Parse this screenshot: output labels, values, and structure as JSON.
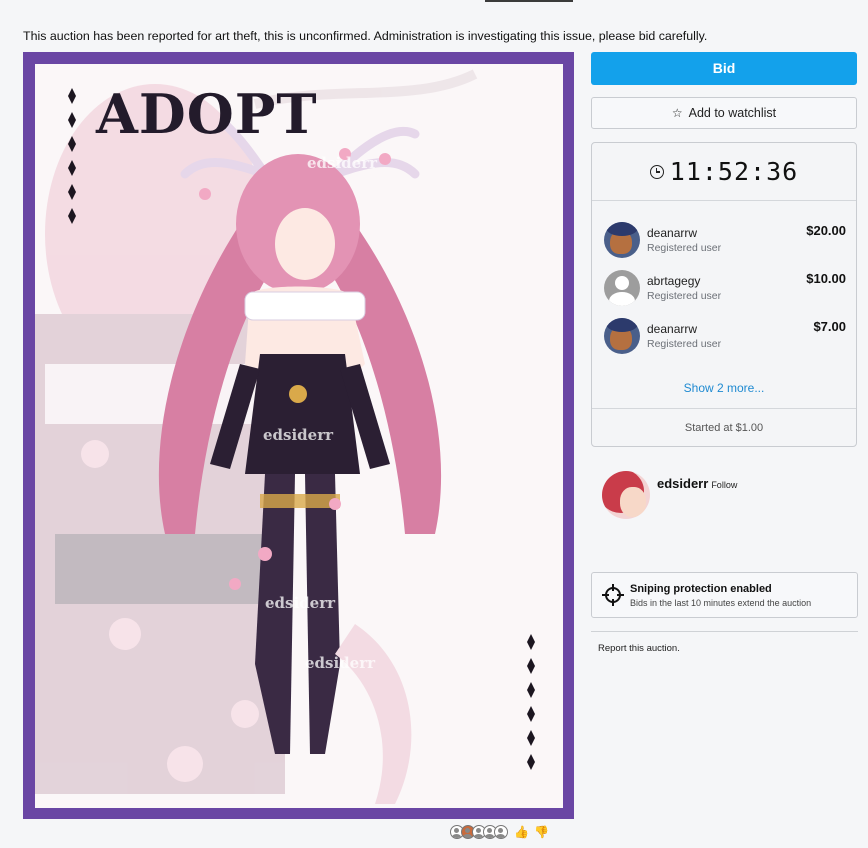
{
  "notice": "This auction has been reported for art theft, this is unconfirmed. Administration is investigating this issue, please bid carefully.",
  "artwork": {
    "title_text": "ADOPT",
    "watermark": "edsiderr",
    "frame_color": "#6a46a4"
  },
  "bid_button": "Bid",
  "watchlist": {
    "label": "Add to watchlist",
    "icon": "star-outline-icon"
  },
  "timer": {
    "icon": "clock-icon",
    "value": "11:52:36"
  },
  "bids": [
    {
      "user": "deanarrw",
      "role": "Registered user",
      "amount": "$20.00",
      "avatar": "art"
    },
    {
      "user": "abrtagegy",
      "role": "Registered user",
      "amount": "$10.00",
      "avatar": "default"
    },
    {
      "user": "deanarrw",
      "role": "Registered user",
      "amount": "$7.00",
      "avatar": "art"
    }
  ],
  "show_more": "Show 2 more...",
  "started_at": "Started at $1.00",
  "seller": {
    "name": "edsiderr",
    "follow_label": "Follow"
  },
  "sniping": {
    "title": "Sniping protection enabled",
    "description": "Bids in the last 10 minutes extend the auction",
    "icon": "crosshair-icon"
  },
  "report_label": "Report this auction.",
  "colors": {
    "accent": "#13a1eb",
    "link": "#1f8ad1"
  }
}
